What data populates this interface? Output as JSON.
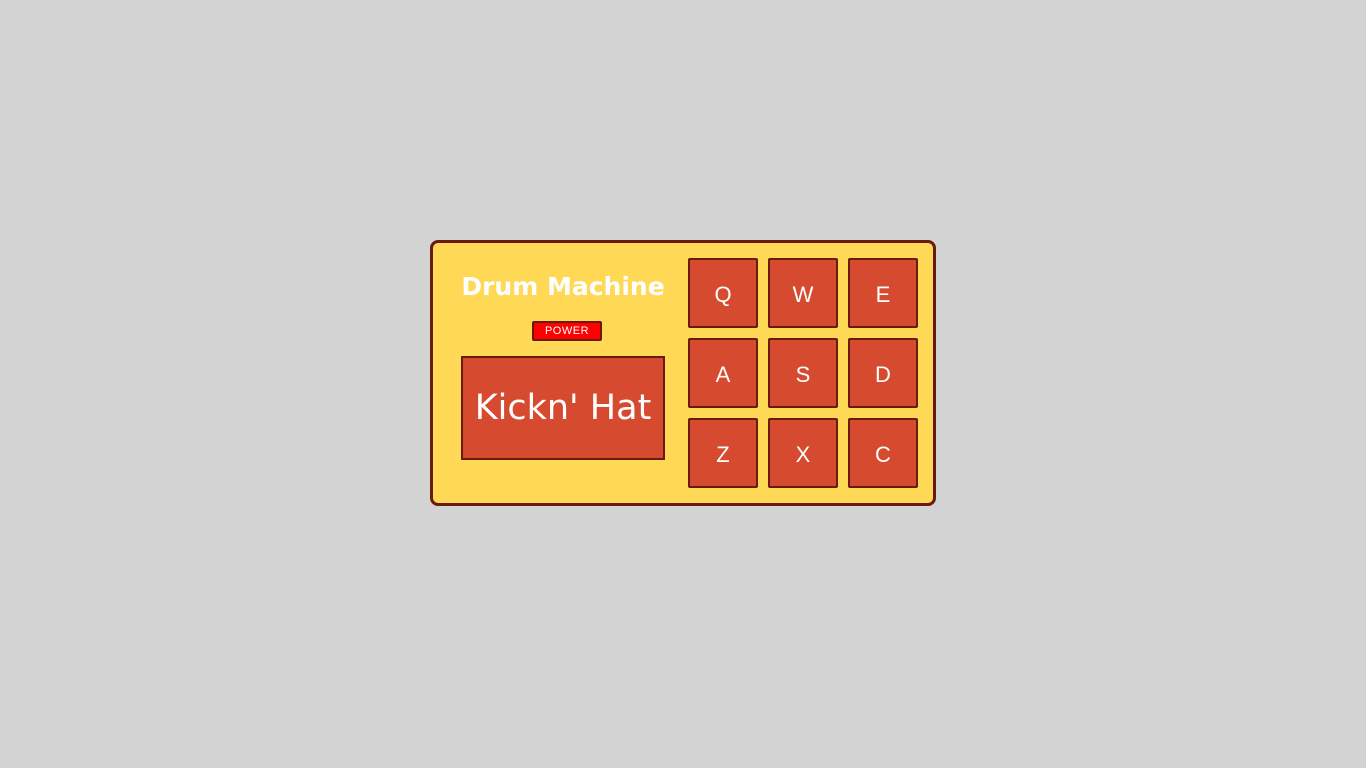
{
  "title": "Drum Machine",
  "power_label": "POWER",
  "display_text": "Kickn' Hat",
  "pads": [
    "Q",
    "W",
    "E",
    "A",
    "S",
    "D",
    "Z",
    "X",
    "C"
  ],
  "colors": {
    "background": "#d3d3d3",
    "panel": "#ffd856",
    "border": "#6b1a10",
    "pad": "#d64a30",
    "power": "#ff0000",
    "text": "#ffffff"
  }
}
